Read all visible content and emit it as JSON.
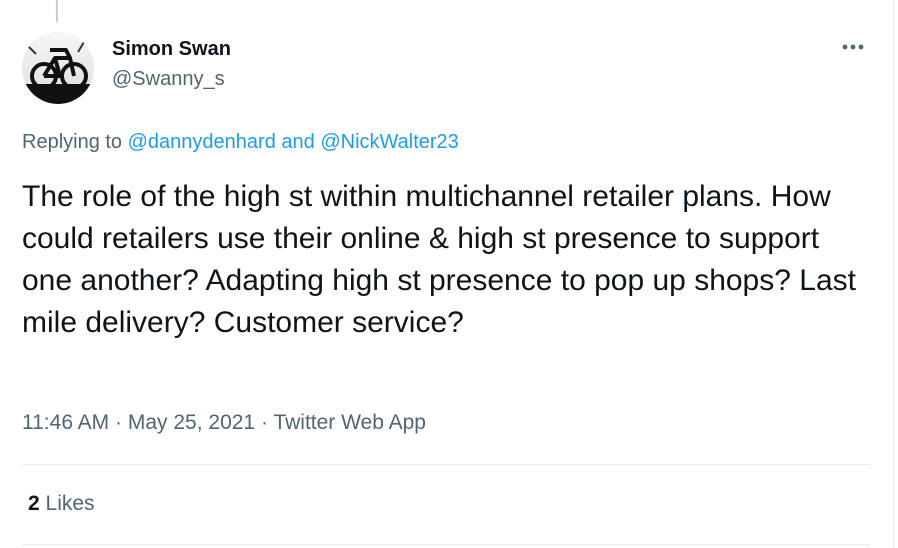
{
  "author": {
    "display_name": "Simon Swan",
    "handle": "@Swanny_s",
    "avatar_icon": "bicycle-silhouette-avatar"
  },
  "reply_context": {
    "prefix": "Replying to",
    "mention_1": "@dannydenhard",
    "joiner": "and",
    "mention_2": "@NickWalter23"
  },
  "tweet": {
    "text": "The role of the high st within multichannel retailer plans. How could retailers use their online & high st presence to support one another? Adapting high st presence to pop up shops? Last mile delivery? Customer service?",
    "time": "11:46 AM",
    "separator": "·",
    "date": "May 25, 2021",
    "source": "Twitter Web App"
  },
  "stats": {
    "likes_count": "2",
    "likes_label": "Likes"
  },
  "icons": {
    "more": "more-horizontal-icon"
  },
  "colors": {
    "text_primary": "#0f1419",
    "text_secondary": "#536471",
    "link": "#1d9bf0",
    "divider": "#e6ecf0"
  }
}
